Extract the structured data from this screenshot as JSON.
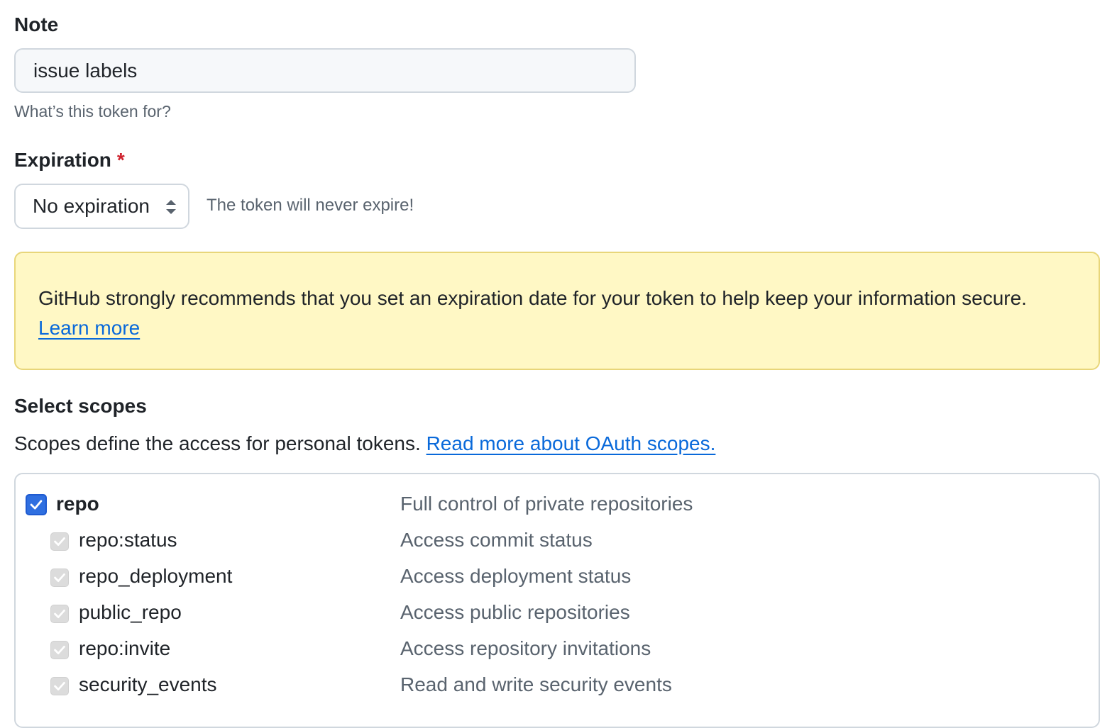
{
  "note": {
    "label": "Note",
    "value": "issue labels",
    "hint": "What’s this token for?"
  },
  "expiration": {
    "label": "Expiration",
    "required_marker": "*",
    "selected": "No expiration",
    "note": "The token will never expire!"
  },
  "warning": {
    "message": "GitHub strongly recommends that you set an expiration date for your token to help keep your information secure.",
    "link_text": "Learn more",
    "background_color": "#fff8c5",
    "border_color": "#e8d67a"
  },
  "scopes": {
    "label": "Select scopes",
    "description": "Scopes define the access for personal tokens.",
    "link_text": "Read more about OAuth scopes.",
    "items": [
      {
        "name": "repo",
        "description": "Full control of private repositories",
        "checked": true
      },
      {
        "name": "repo:status",
        "description": "Access commit status",
        "checked": true
      },
      {
        "name": "repo_deployment",
        "description": "Access deployment status",
        "checked": true
      },
      {
        "name": "public_repo",
        "description": "Access public repositories",
        "checked": true
      },
      {
        "name": "repo:invite",
        "description": "Access repository invitations",
        "checked": true
      },
      {
        "name": "security_events",
        "description": "Read and write security events",
        "checked": true
      }
    ]
  },
  "colors": {
    "link": "#0969da",
    "required": "#cf222e",
    "checkbox_checked": "#2f6fe0",
    "checkbox_disabled": "#dcdcdc"
  }
}
